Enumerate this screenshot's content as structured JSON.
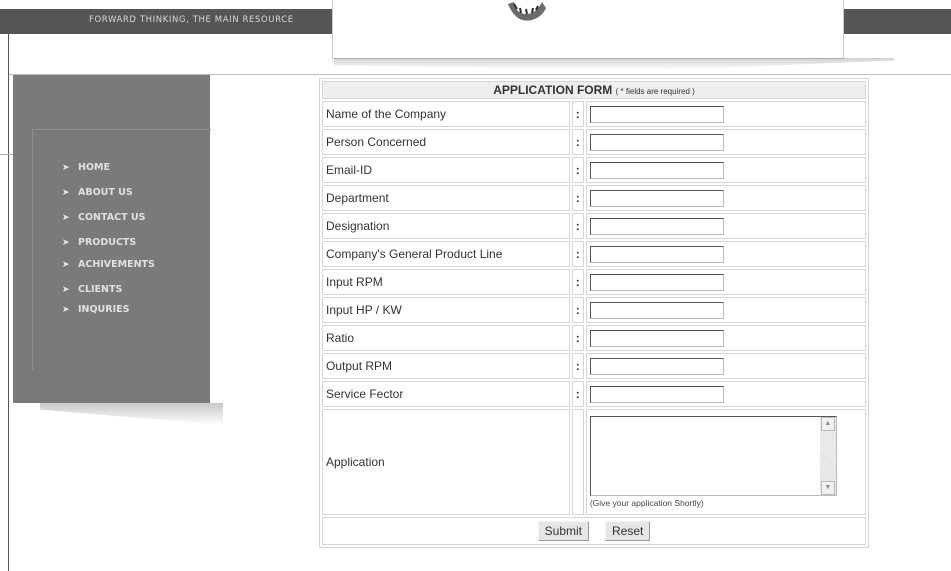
{
  "header": {
    "tagline": "FORWARD THINKING, THE MAIN RESOURCE"
  },
  "nav": {
    "items": [
      {
        "label": "HOME"
      },
      {
        "label": "ABOUT US"
      },
      {
        "label": "CONTACT US"
      },
      {
        "label": "PRODUCTS"
      },
      {
        "label": "ACHIVEMENTS"
      },
      {
        "label": "CLIENTS"
      },
      {
        "label": "INQURIES"
      }
    ]
  },
  "form": {
    "title": "APPLICATION FORM",
    "required_note": "( * fields are required )",
    "colon": ":",
    "fields": [
      {
        "label": "Name of the Company",
        "value": ""
      },
      {
        "label": "Person Concerned",
        "value": ""
      },
      {
        "label": "Email-ID",
        "value": ""
      },
      {
        "label": "Department",
        "value": ""
      },
      {
        "label": "Designation",
        "value": ""
      },
      {
        "label": "Company's General Product Line",
        "value": ""
      },
      {
        "label": "Input RPM",
        "value": ""
      },
      {
        "label": "Input HP / KW",
        "value": ""
      },
      {
        "label": "Ratio",
        "value": ""
      },
      {
        "label": "Output RPM",
        "value": ""
      },
      {
        "label": "Service Fector",
        "value": ""
      }
    ],
    "application": {
      "label": "Application",
      "value": "",
      "hint": "(Give your application Shortly)"
    },
    "submit_label": "Submit",
    "reset_label": "Reset"
  },
  "colors": {
    "header_bar": "#555555",
    "sidebar": "#7a7a7a",
    "form_border": "#d6d6d6",
    "title_bg": "#eeeeee"
  }
}
